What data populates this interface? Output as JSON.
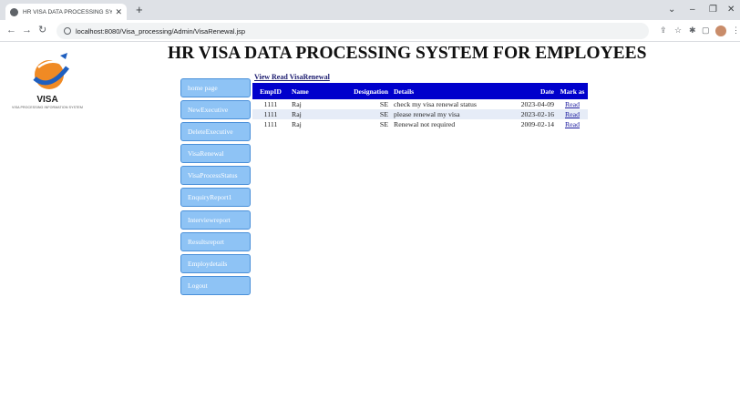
{
  "browser": {
    "tab_title": "HR VISA DATA PROCESSING SYS",
    "url": "localhost:8080/Visa_processing/Admin/VisaRenewal.jsp"
  },
  "logo": {
    "label": "VISA",
    "subtitle": "VISA PROCESSING INFORMATION SYSTEM"
  },
  "page": {
    "title": "HR VISA DATA PROCESSING SYSTEM FOR EMPLOYEES",
    "view_link": "View Read VisaRenewal"
  },
  "sidebar": {
    "items": [
      {
        "label": "home page"
      },
      {
        "label": "NewExecutive"
      },
      {
        "label": "DeleteExecutive"
      },
      {
        "label": "VisaRenewal"
      },
      {
        "label": "VisaProcessStatus"
      },
      {
        "label": "EnquiryReport1"
      },
      {
        "label": "Interviewreport"
      },
      {
        "label": "Resultsreport"
      },
      {
        "label": "Employdetails"
      },
      {
        "label": "Logout"
      }
    ]
  },
  "table": {
    "headers": {
      "empid": "EmpID",
      "name": "Name",
      "designation": "Designation",
      "details": "Details",
      "date": "Date",
      "mark_as": "Mark as"
    },
    "rows": [
      {
        "empid": "1111",
        "name": "Raj",
        "designation": "SE",
        "details": "check my visa renewal status",
        "date": "2023-04-09",
        "action": "Read"
      },
      {
        "empid": "1111",
        "name": "Raj",
        "designation": "SE",
        "details": "please renewal my visa",
        "date": "2023-02-16",
        "action": "Read"
      },
      {
        "empid": "1111",
        "name": "Raj",
        "designation": "SE",
        "details": "Renewal not required",
        "date": "2009-02-14",
        "action": "Read"
      }
    ]
  },
  "colors": {
    "table_header": "#0000cc",
    "nav_button": "#8ec3f5",
    "nav_border": "#4a90d9"
  }
}
